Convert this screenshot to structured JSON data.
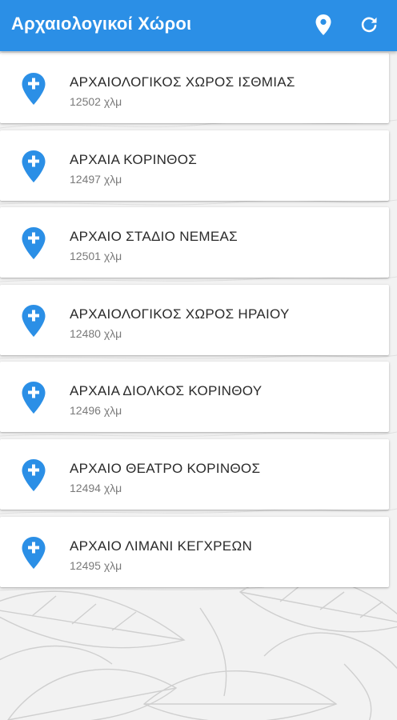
{
  "appbar": {
    "title": "Αρχαιολογικοί Χώροι",
    "location_icon": "location-pin-icon",
    "refresh_icon": "refresh-icon",
    "color": "#2b8fe6"
  },
  "sites": [
    {
      "name": "ΑΡΧΑΙΟΛΟΓΙΚΟΣ ΧΩΡΟΣ ΙΣΘΜΙΑΣ",
      "distance": "12502 χλμ"
    },
    {
      "name": "ΑΡΧΑΙΑ ΚΟΡΙΝΘΟΣ",
      "distance": "12497 χλμ"
    },
    {
      "name": "ΑΡΧΑΙΟ ΣΤΑΔΙΟ ΝΕΜΕΑΣ",
      "distance": "12501 χλμ"
    },
    {
      "name": "ΑΡΧΑΙΟΛΟΓΙΚΟΣ ΧΩΡΟΣ ΗΡΑΙΟΥ",
      "distance": "12480 χλμ"
    },
    {
      "name": "ΑΡΧΑΙΑ ΔΙΟΛΚΟΣ ΚΟΡΙΝΘΟΥ",
      "distance": "12496 χλμ"
    },
    {
      "name": "ΑΡΧΑΙΟ ΘΕΑΤΡΟ ΚΟΡΙΝΘΟΣ",
      "distance": "12494 χλμ"
    },
    {
      "name": "ΑΡΧΑΙΟ ΛΙΜΑΝΙ ΚΕΓΧΡΕΩΝ",
      "distance": "12495 χλμ"
    }
  ],
  "item_icon": "add-location-pin-icon",
  "pin_color": "#2b8fe6"
}
